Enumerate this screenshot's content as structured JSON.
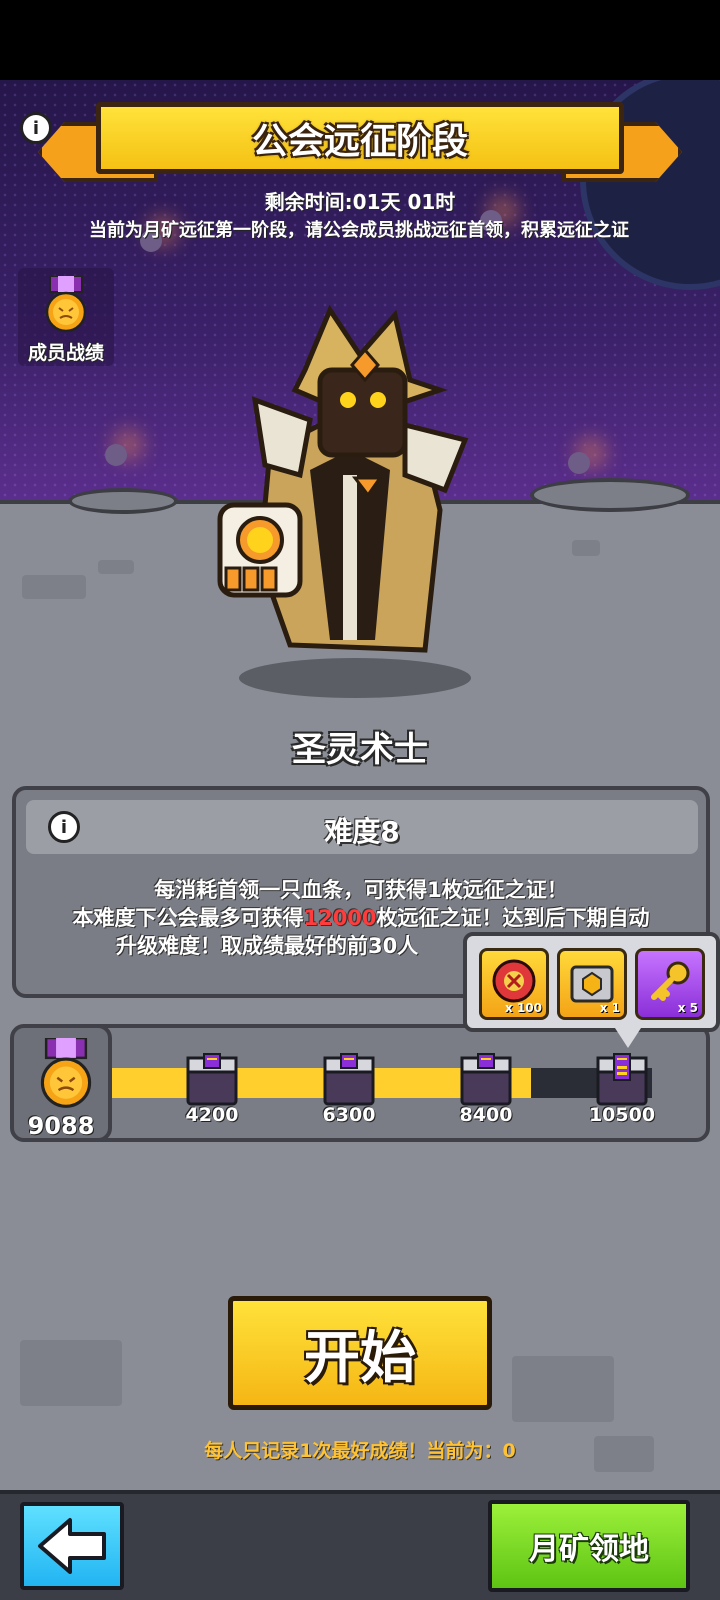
{
  "header": {
    "title": "公会远征阶段",
    "info_icon": "info-icon",
    "remaining_time": "剩余时间:01天 01时",
    "description": "当前为月矿远征第一阶段，请公会成员挑战远征首领，积累远征之证"
  },
  "member_stats": {
    "label": "成员战绩",
    "icon": "medal-icon"
  },
  "boss": {
    "name": "圣灵术士"
  },
  "difficulty": {
    "title": "难度8",
    "line1": "每消耗首领一只血条，可获得1枚远征之证！",
    "line2_prefix": "本难度下公会最多可获得",
    "line2_highlight": "12000",
    "line2_suffix": "枚远征之证！达到后下期自动",
    "line3": "升级难度！取成绩最好的前30人"
  },
  "rewards_popup": {
    "items": [
      {
        "icon": "red-shield-icon",
        "qty": "x 100"
      },
      {
        "icon": "chest-token-icon",
        "qty": "x 1"
      },
      {
        "icon": "purple-key-icon",
        "qty": "x 5"
      }
    ]
  },
  "progress": {
    "current_score": "9088",
    "current_value": 9088,
    "max_value": 10500,
    "milestones": [
      "4200",
      "6300",
      "8400",
      "10500"
    ]
  },
  "actions": {
    "start_label": "开始",
    "record_note": "每人只记录1次最好成绩！当前为：0",
    "back_icon": "back-arrow-icon",
    "map_label": "月矿领地"
  },
  "colors": {
    "gold": "#ffcf2e",
    "highlight_red": "#ff3b3b",
    "note_yellow": "#ffc233",
    "back_blue": "#22b4f2",
    "map_green": "#5ec414"
  }
}
